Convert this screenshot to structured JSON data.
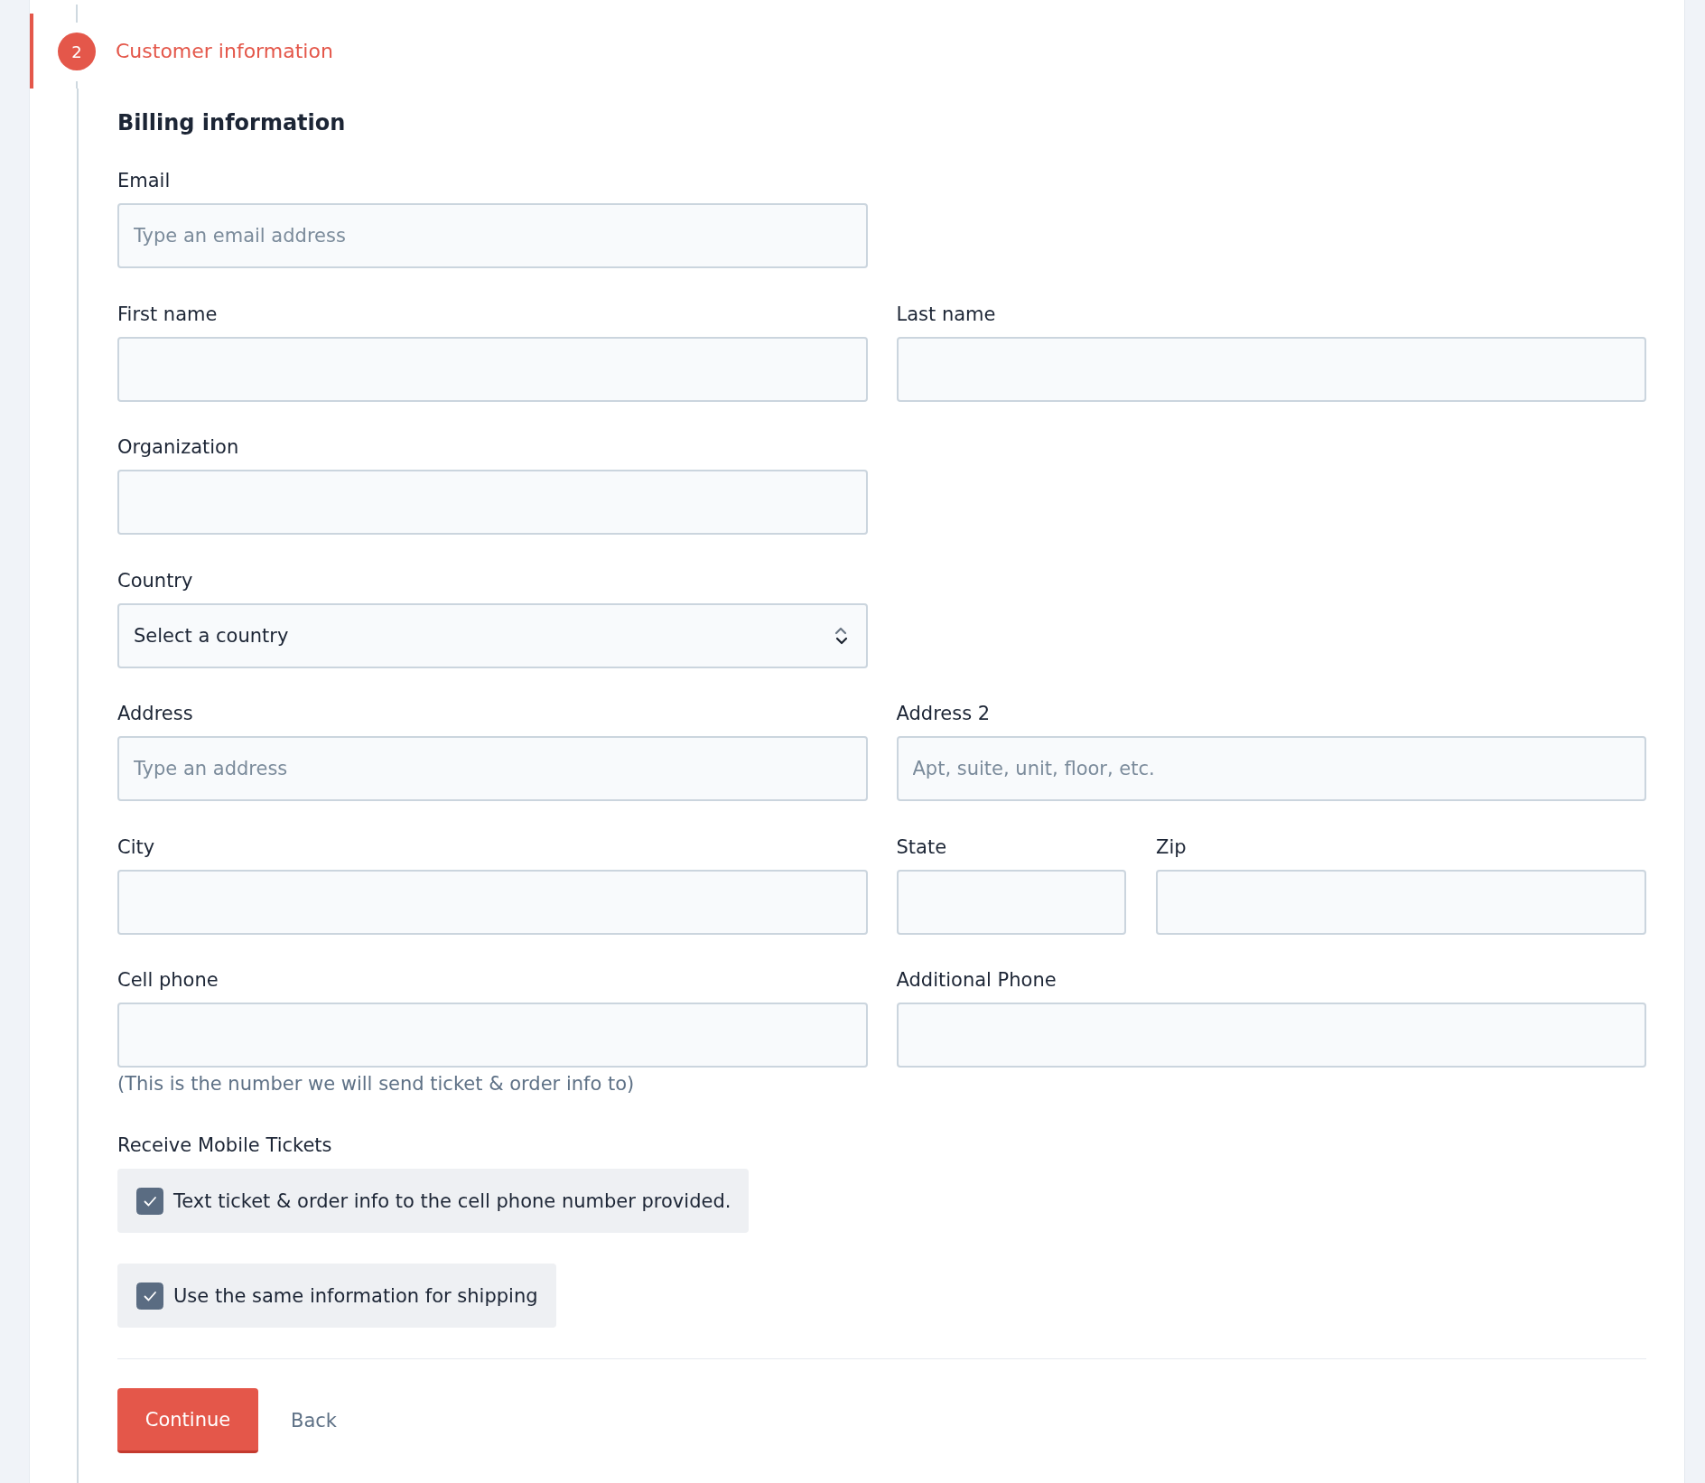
{
  "step": {
    "number": "2",
    "title": "Customer information",
    "active": true
  },
  "section": {
    "title": "Billing information"
  },
  "rows": [
    {
      "fields": [
        {
          "label": "Email",
          "kind": "text",
          "placeholder": "Type an email address"
        }
      ]
    },
    {
      "fields": [
        {
          "label": "First name",
          "kind": "text"
        },
        {
          "label": "Last name",
          "kind": "text"
        }
      ]
    },
    {
      "fields": [
        {
          "label": "Organization",
          "kind": "text"
        }
      ]
    },
    {
      "fields": [
        {
          "label": "Country",
          "kind": "select",
          "value": "Select a country"
        }
      ]
    },
    {
      "fields": [
        {
          "label": "Address",
          "kind": "text",
          "placeholder": "Type an address"
        },
        {
          "label": "Address 2",
          "kind": "text",
          "placeholder": "Apt, suite, unit, floor, etc."
        }
      ]
    },
    {
      "fields": [
        {
          "label": "City",
          "kind": "text"
        },
        {
          "label": "State",
          "kind": "text"
        },
        {
          "label": "Zip",
          "kind": "text"
        }
      ]
    },
    {
      "fields": [
        {
          "label": "Cell phone",
          "kind": "text",
          "hint": "(This is the number we will send ticket & order info to)"
        },
        {
          "label": "Additional Phone",
          "kind": "text"
        }
      ]
    }
  ],
  "mobile_tickets": {
    "label": "Receive Mobile Tickets",
    "option": {
      "label": "Text ticket & order info to the cell phone number provided.",
      "checked": true
    }
  },
  "shipping_option": {
    "label": "Use the same information for shipping",
    "checked": true
  },
  "actions": [
    {
      "label": "Continue",
      "kind": "primary"
    },
    {
      "label": "Back",
      "kind": "link"
    }
  ]
}
